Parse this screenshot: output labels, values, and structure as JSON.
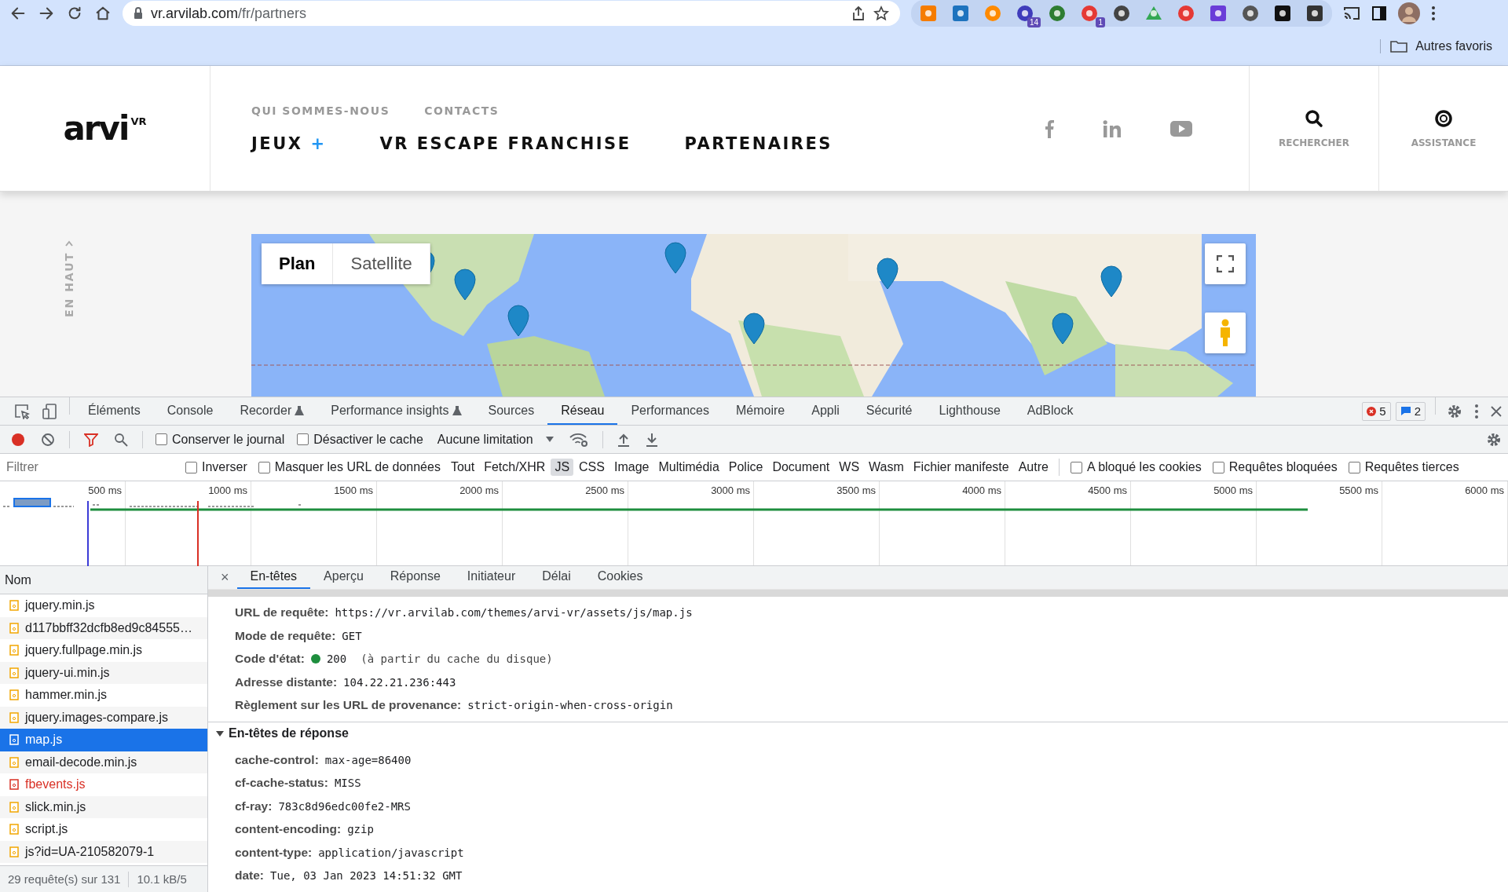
{
  "browser": {
    "url_host": "vr.arvilab.com",
    "url_path": "/fr/partners",
    "extension_badges": [
      {
        "text": "14"
      },
      {
        "text": "1"
      }
    ],
    "bookmark_folder": "Autres favoris"
  },
  "site": {
    "logo": "arvi",
    "logo_sup": "VR",
    "top_nav": [
      "QUI SOMMES-NOUS",
      "CONTACTS"
    ],
    "main_nav": [
      {
        "label": "JEUX",
        "plus": "+"
      },
      {
        "label": "VR ESCAPE FRANCHISE"
      },
      {
        "label": "PARTENAIRES"
      }
    ],
    "actions": [
      {
        "kind": "search",
        "label": "RECHERCHER"
      },
      {
        "kind": "help",
        "label": "ASSISTANCE"
      }
    ],
    "back_to_top": "EN HAUT",
    "map_types": [
      {
        "label": "Plan",
        "selected": true
      },
      {
        "label": "Satellite",
        "selected": false
      }
    ]
  },
  "devtools": {
    "tabs": [
      {
        "label": "Éléments",
        "selected": false
      },
      {
        "label": "Console",
        "selected": false
      },
      {
        "label": "Recorder",
        "flask": true,
        "selected": false
      },
      {
        "label": "Performance insights",
        "flask": true,
        "selected": false
      },
      {
        "label": "Sources",
        "selected": false
      },
      {
        "label": "Réseau",
        "selected": true
      },
      {
        "label": "Performances",
        "selected": false
      },
      {
        "label": "Mémoire",
        "selected": false
      },
      {
        "label": "Appli",
        "selected": false
      },
      {
        "label": "Sécurité",
        "selected": false
      },
      {
        "label": "Lighthouse",
        "selected": false
      },
      {
        "label": "AdBlock",
        "selected": false
      }
    ],
    "errors": "5",
    "messages": "2",
    "toolbar": {
      "recording": true,
      "filter_active": true,
      "checkboxes": [
        {
          "label": "Conserver le journal",
          "checked": false
        },
        {
          "label": "Désactiver le cache",
          "checked": false
        }
      ],
      "throttling": "Aucune limitation"
    },
    "filter": {
      "placeholder": "Filtrer",
      "pre_checks": [
        {
          "label": "Inverser",
          "checked": false
        },
        {
          "label": "Masquer les URL de données",
          "checked": false
        }
      ],
      "types": [
        {
          "label": "Tout",
          "selected": false
        },
        {
          "label": "Fetch/XHR",
          "selected": false
        },
        {
          "label": "JS",
          "selected": true
        },
        {
          "label": "CSS",
          "selected": false
        },
        {
          "label": "Image",
          "selected": false
        },
        {
          "label": "Multimédia",
          "selected": false
        },
        {
          "label": "Police",
          "selected": false
        },
        {
          "label": "Document",
          "selected": false
        },
        {
          "label": "WS",
          "selected": false
        },
        {
          "label": "Wasm",
          "selected": false
        },
        {
          "label": "Fichier manifeste",
          "selected": false
        },
        {
          "label": "Autre",
          "selected": false
        }
      ],
      "post_checks": [
        {
          "label": "A bloqué les cookies",
          "checked": false
        },
        {
          "label": "Requêtes bloquées",
          "checked": false
        },
        {
          "label": "Requêtes tierces",
          "checked": false
        }
      ]
    },
    "timeline": {
      "ticks": [
        "500 ms",
        "1000 ms",
        "1500 ms",
        "2000 ms",
        "2500 ms",
        "3000 ms",
        "3500 ms",
        "4000 ms",
        "4500 ms",
        "5000 ms",
        "5500 ms",
        "6000 ms"
      ]
    },
    "requests": {
      "column": "Nom",
      "rows": [
        {
          "name": "jquery.min.js",
          "selected": false,
          "failed": false
        },
        {
          "name": "d117bbff32dcfb8ed9c84555…",
          "selected": false,
          "failed": false
        },
        {
          "name": "jquery.fullpage.min.js",
          "selected": false,
          "failed": false
        },
        {
          "name": "jquery-ui.min.js",
          "selected": false,
          "failed": false
        },
        {
          "name": "hammer.min.js",
          "selected": false,
          "failed": false
        },
        {
          "name": "jquery.images-compare.js",
          "selected": false,
          "failed": false
        },
        {
          "name": "map.js",
          "selected": true,
          "failed": false
        },
        {
          "name": "email-decode.min.js",
          "selected": false,
          "failed": false
        },
        {
          "name": "fbevents.js",
          "selected": false,
          "failed": true
        },
        {
          "name": "slick.min.js",
          "selected": false,
          "failed": false
        },
        {
          "name": "script.js",
          "selected": false,
          "failed": false
        },
        {
          "name": "js?id=UA-210582079-1",
          "selected": false,
          "failed": false
        }
      ],
      "summary": "29 requête(s) sur 131",
      "transferred": "10.1 kB/5"
    },
    "details": {
      "close": "×",
      "tabs": [
        {
          "label": "En-têtes",
          "selected": true
        },
        {
          "label": "Aperçu",
          "selected": false
        },
        {
          "label": "Réponse",
          "selected": false
        },
        {
          "label": "Initiateur",
          "selected": false
        },
        {
          "label": "Délai",
          "selected": false
        },
        {
          "label": "Cookies",
          "selected": false
        }
      ],
      "general": [
        {
          "label": "URL de requête:",
          "value": "https://vr.arvilab.com/themes/arvi-vr/assets/js/map.js"
        },
        {
          "label": "Mode de requête:",
          "value": "GET"
        },
        {
          "label": "Code d'état:",
          "value": "200",
          "ok": true,
          "note": "(à partir du cache du disque)"
        },
        {
          "label": "Adresse distante:",
          "value": "104.22.21.236:443"
        },
        {
          "label": "Règlement sur les URL de provenance:",
          "value": "strict-origin-when-cross-origin"
        }
      ],
      "response_section": {
        "title": "En-têtes de réponse",
        "expanded": true,
        "rows": [
          {
            "label": "cache-control:",
            "value": "max-age=86400"
          },
          {
            "label": "cf-cache-status:",
            "value": "MISS"
          },
          {
            "label": "cf-ray:",
            "value": "783c8d96edc00fe2-MRS"
          },
          {
            "label": "content-encoding:",
            "value": "gzip"
          },
          {
            "label": "content-type:",
            "value": "application/javascript"
          },
          {
            "label": "date:",
            "value": "Tue, 03 Jan 2023 14:51:32 GMT"
          }
        ]
      }
    }
  }
}
